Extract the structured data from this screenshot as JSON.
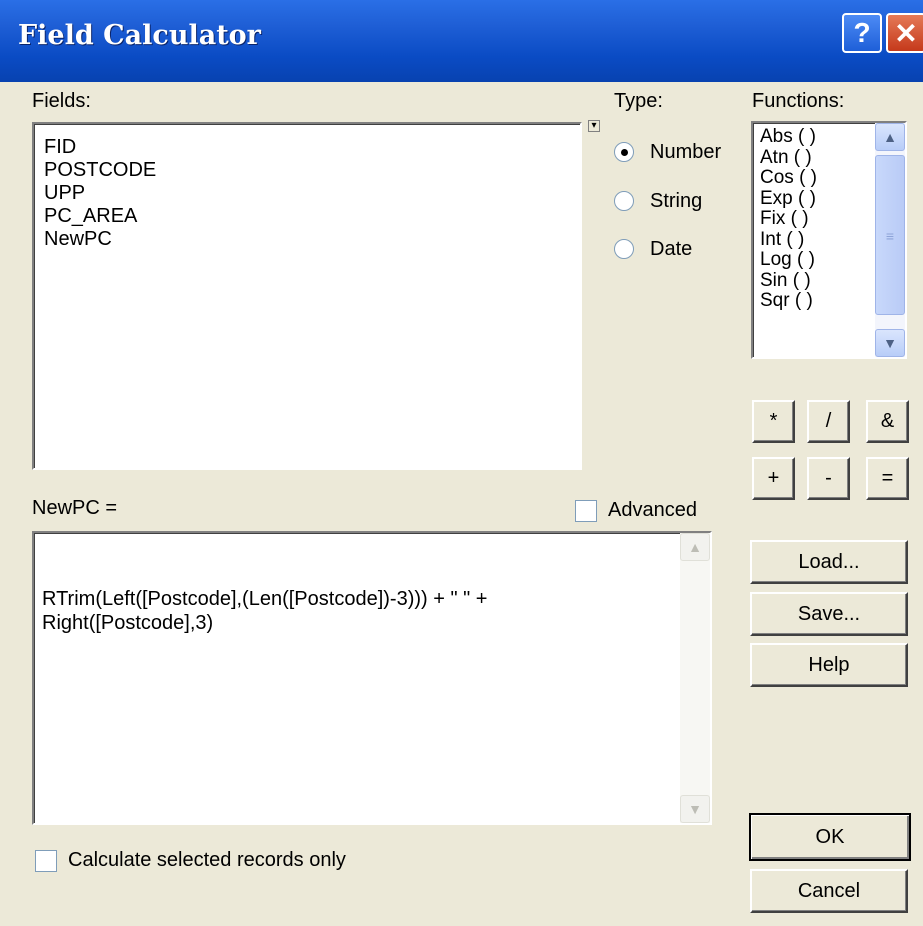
{
  "window": {
    "title": "Field Calculator",
    "help_label": "?",
    "close_label": "✕"
  },
  "fields": {
    "label": "Fields:",
    "items": [
      "FID",
      "POSTCODE",
      "UPP",
      "PC_AREA",
      "NewPC"
    ]
  },
  "type": {
    "label": "Type:",
    "options": [
      "Number",
      "String",
      "Date"
    ],
    "selected": "Number"
  },
  "functions": {
    "label": "Functions:",
    "items": [
      "Abs ( )",
      "Atn ( )",
      "Cos ( )",
      "Exp ( )",
      "Fix ( )",
      "Int ( )",
      "Log ( )",
      "Sin ( )",
      "Sqr ( )"
    ]
  },
  "operators": [
    "*",
    "/",
    "&",
    "+",
    "-",
    "="
  ],
  "expression": {
    "label": "NewPC =",
    "advanced_label": "Advanced",
    "advanced_checked": false,
    "text": "RTrim(Left([Postcode],(Len([Postcode])-3))) + \" \" +\nRight([Postcode],3)"
  },
  "buttons": {
    "load": "Load...",
    "save": "Save...",
    "help": "Help",
    "ok": "OK",
    "cancel": "Cancel"
  },
  "selected_only": {
    "label": "Calculate selected records only",
    "checked": false
  }
}
